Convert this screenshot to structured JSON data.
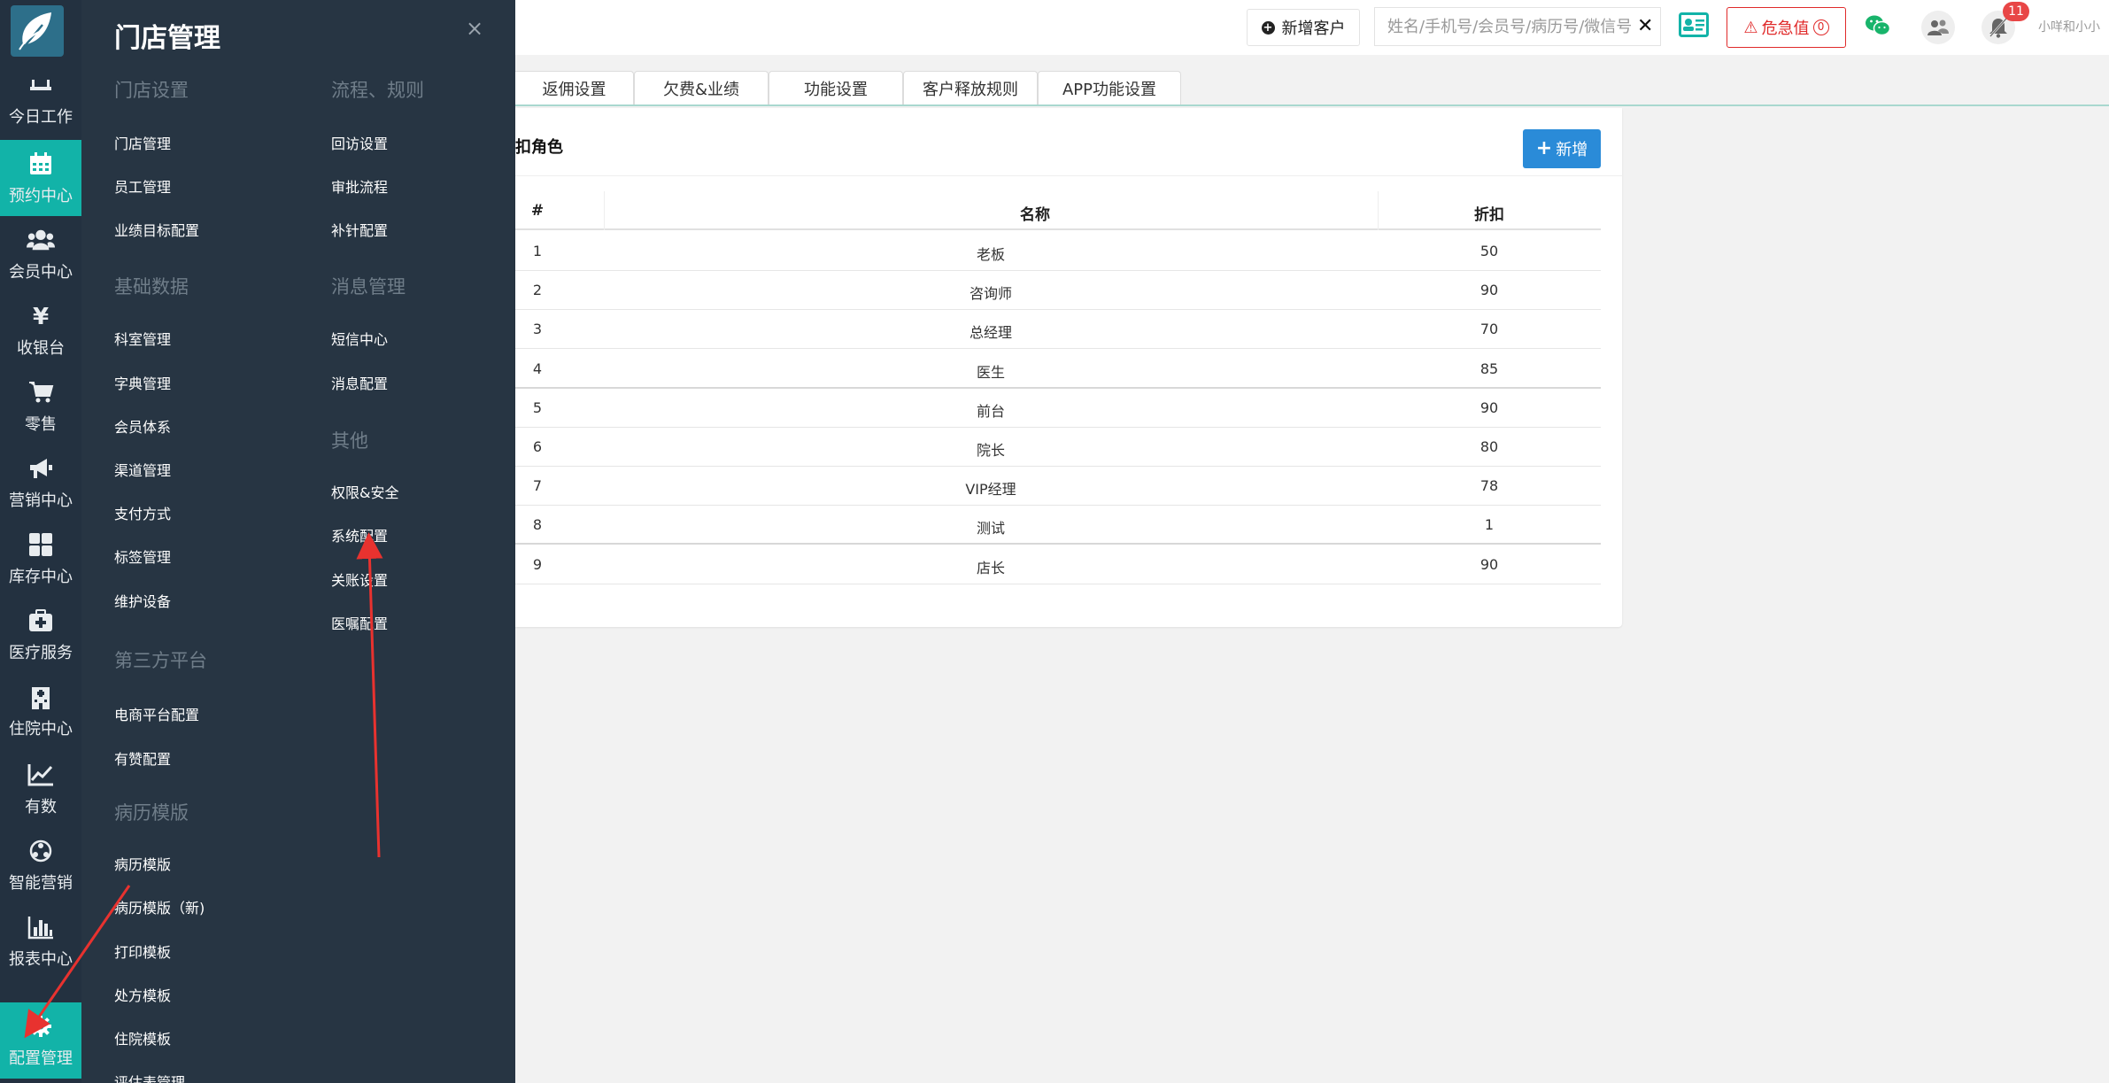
{
  "rail": {
    "items": [
      {
        "label": "今日工作",
        "icon": "desk-icon"
      },
      {
        "label": "预约中心",
        "icon": "calendar-icon",
        "active": true
      },
      {
        "label": "会员中心",
        "icon": "users-icon"
      },
      {
        "label": "收银台",
        "icon": "yen-icon"
      },
      {
        "label": "零售",
        "icon": "cart-icon"
      },
      {
        "label": "营销中心",
        "icon": "megaphone-icon"
      },
      {
        "label": "库存中心",
        "icon": "grid-icon"
      },
      {
        "label": "医疗服务",
        "icon": "medkit-icon"
      },
      {
        "label": "住院中心",
        "icon": "hospital-icon"
      },
      {
        "label": "有数",
        "icon": "line-chart-icon"
      },
      {
        "label": "智能营销",
        "icon": "network-icon"
      },
      {
        "label": "报表中心",
        "icon": "bar-chart-icon"
      },
      {
        "label": "配置管理",
        "icon": "gear-icon",
        "active": true
      }
    ]
  },
  "menu": {
    "title": "门店管理",
    "close": "×",
    "left_column": {
      "sections": [
        {
          "heading": "门店设置",
          "links": [
            "门店管理",
            "员工管理",
            "业绩目标配置"
          ]
        },
        {
          "heading": "基础数据",
          "links": [
            "科室管理",
            "字典管理",
            "会员体系",
            "渠道管理",
            "支付方式",
            "标签管理",
            "维护设备"
          ]
        },
        {
          "heading": "第三方平台",
          "links": [
            "电商平台配置",
            "有赞配置"
          ]
        },
        {
          "heading": "病历模版",
          "links": [
            "病历模版",
            "病历模版（新)",
            "打印模板",
            "处方模板",
            "住院模板",
            "评估表管理"
          ]
        }
      ]
    },
    "right_column": {
      "sections": [
        {
          "heading": "流程、规则",
          "links": [
            "回访设置",
            "审批流程",
            "补针配置"
          ]
        },
        {
          "heading": "消息管理",
          "links": [
            "短信中心",
            "消息配置"
          ]
        },
        {
          "heading": "其他",
          "links": [
            "权限&安全",
            "系统配置",
            "关账设置",
            "医嘱配置"
          ]
        }
      ]
    }
  },
  "header": {
    "add_customer": "新增客户",
    "search_placeholder": "姓名/手机号/会员号/病历号/微信号",
    "clear": "✕",
    "danger_label": "危急值",
    "danger_count": "0",
    "notification_count": "11",
    "user": "小咩和小小"
  },
  "tabs": [
    "返佣设置",
    "欠费&业绩",
    "功能设置",
    "客户释放规则",
    "APP功能设置"
  ],
  "panel": {
    "title": "扣角色",
    "new_button": "新增",
    "columns": [
      "#",
      "名称",
      "折扣"
    ],
    "rows": [
      [
        "1",
        "老板",
        "50"
      ],
      [
        "2",
        "咨询师",
        "90"
      ],
      [
        "3",
        "总经理",
        "70"
      ],
      [
        "4",
        "医生",
        "85"
      ],
      [
        "5",
        "前台",
        "90"
      ],
      [
        "6",
        "院长",
        "80"
      ],
      [
        "7",
        "VIP经理",
        "78"
      ],
      [
        "8",
        "测试",
        "1"
      ],
      [
        "9",
        "店长",
        "90"
      ]
    ]
  },
  "colors": {
    "rail_bg": "#233140",
    "menu_bg": "#273543",
    "active": "#12b3a8",
    "primary": "#2a8bd8",
    "danger": "#e02a2a",
    "arrow": "#e8322f"
  }
}
